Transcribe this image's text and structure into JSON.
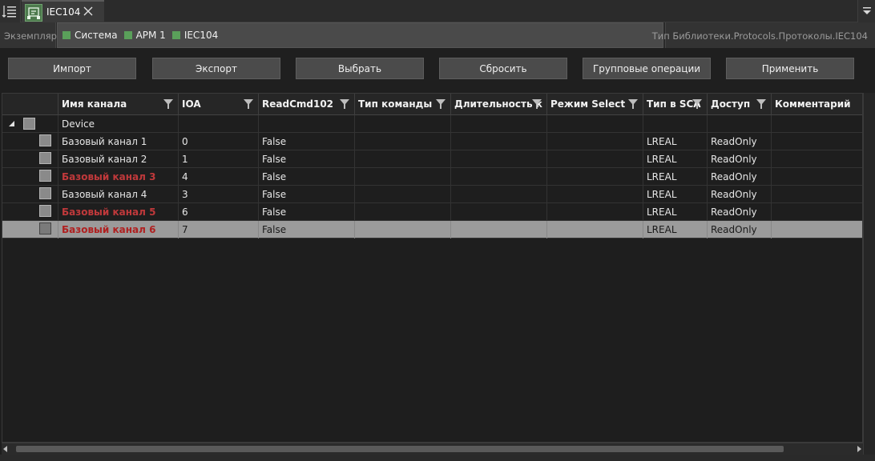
{
  "tabs": {
    "active_label": "IEC104"
  },
  "breadcrumb": {
    "instance_label": "Экземпляр",
    "items": [
      "Система",
      "АРМ 1",
      "IEC104"
    ],
    "type_path": "Тип Библиотеки.Protocols.Протоколы.IEC104"
  },
  "toolbar": {
    "import_label": "Импорт",
    "export_label": "Экспорт",
    "select_label": "Выбрать",
    "reset_label": "Сбросить",
    "group_ops_label": "Групповые операции",
    "apply_label": "Применить"
  },
  "grid": {
    "columns": [
      "Имя канала",
      "IOA",
      "ReadCmd102",
      "Тип команды",
      "Длительность к",
      "Режим Select",
      "Тип в SCA",
      "Доступ",
      "Комментарий"
    ],
    "group_label": "Device",
    "rows": [
      {
        "name": "Базовый канал 1",
        "ioa": "0",
        "readcmd": "False",
        "type": "LREAL",
        "access": "ReadOnly"
      },
      {
        "name": "Базовый канал 2",
        "ioa": "1",
        "readcmd": "False",
        "type": "LREAL",
        "access": "ReadOnly"
      },
      {
        "name": "Базовый канал 3",
        "ioa": "4",
        "readcmd": "False",
        "type": "LREAL",
        "access": "ReadOnly"
      },
      {
        "name": "Базовый канал 4",
        "ioa": "3",
        "readcmd": "False",
        "type": "LREAL",
        "access": "ReadOnly"
      },
      {
        "name": "Базовый канал 5",
        "ioa": "6",
        "readcmd": "False",
        "type": "LREAL",
        "access": "ReadOnly"
      },
      {
        "name": "Базовый канал 6",
        "ioa": "7",
        "readcmd": "False",
        "type": "LREAL",
        "access": "ReadOnly"
      }
    ]
  },
  "colors": {
    "error_text": "#c0393b",
    "accent_green": "#5aa05a",
    "selected_row": "#9b9b9b"
  }
}
